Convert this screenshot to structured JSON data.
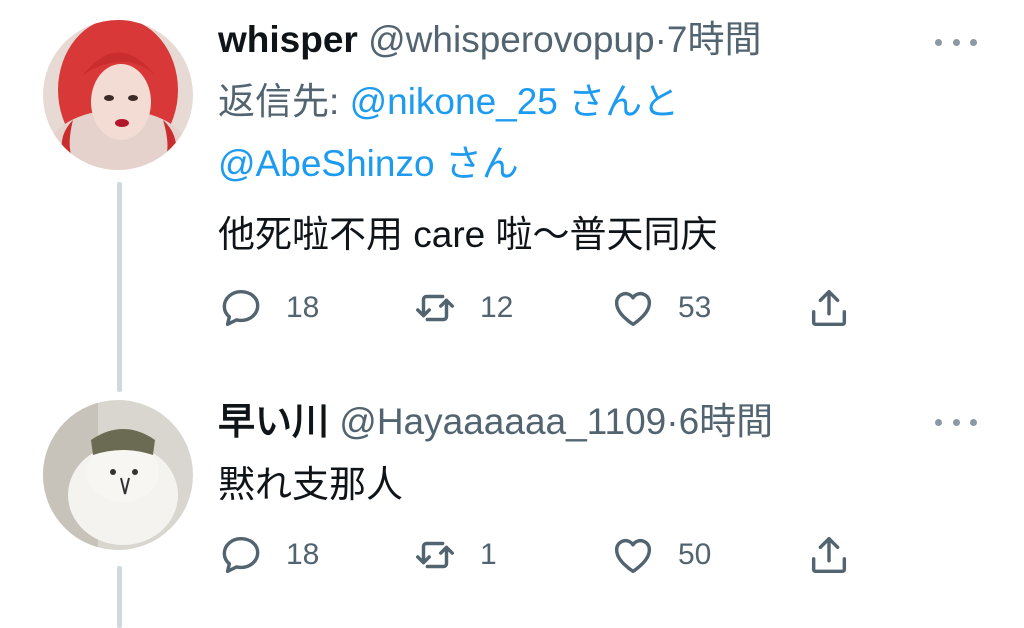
{
  "tweets": [
    {
      "name": "whisper",
      "handle": "@whisperovopup",
      "separator": "·",
      "time": "7時間",
      "reply_prefix": "返信先: ",
      "mention1": "@nikone_25",
      "mention1_suffix": "さんと",
      "mention2": "@AbeShinzo",
      "mention2_suffix": "さん",
      "text": "他死啦不用 care 啦～普天同庆",
      "replies": "18",
      "retweets": "12",
      "likes": "53"
    },
    {
      "name": "早い川",
      "handle": "@Hayaaaaaa_1109",
      "separator": "·",
      "time": "6時間",
      "text": "黙れ支那人",
      "replies": "18",
      "retweets": "1",
      "likes": "50"
    }
  ],
  "colors": {
    "accent": "#1d9bf0",
    "secondary_text": "#536471",
    "thread_line": "#cfd9de"
  },
  "icons": [
    "reply-icon",
    "retweet-icon",
    "like-icon",
    "share-icon",
    "more-icon"
  ]
}
